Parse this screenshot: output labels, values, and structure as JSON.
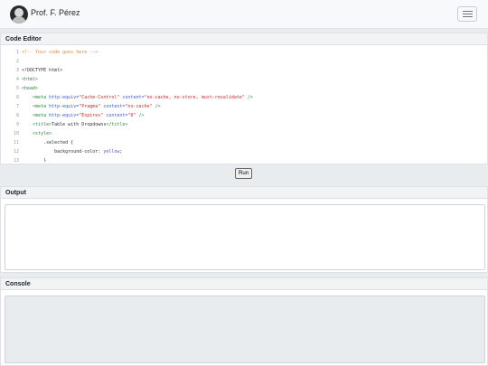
{
  "navbar": {
    "brand": "Prof. F. Pérez",
    "menu_icon": "hamburger-menu-icon"
  },
  "editor": {
    "title": "Code Editor",
    "lines": [
      {
        "n": "1",
        "segs": [
          {
            "t": "<!-- Your code goes here -->",
            "c": "comment"
          }
        ]
      },
      {
        "n": "2",
        "segs": []
      },
      {
        "n": "3",
        "segs": [
          {
            "t": "<!DOCTYPE html>",
            "c": "txt"
          }
        ]
      },
      {
        "n": "4",
        "segs": [
          {
            "t": "<html>",
            "c": "tag"
          }
        ]
      },
      {
        "n": "5",
        "segs": [
          {
            "t": "<head>",
            "c": "tag"
          }
        ]
      },
      {
        "n": "6",
        "segs": [
          {
            "t": "    <meta ",
            "c": "tag"
          },
          {
            "t": "http-equiv=",
            "c": "attr"
          },
          {
            "t": "\"Cache-Control\"",
            "c": "str"
          },
          {
            "t": " content=",
            "c": "attr"
          },
          {
            "t": "\"no-cache, no-store, must-revalidate\"",
            "c": "str"
          },
          {
            "t": " />",
            "c": "tag"
          }
        ]
      },
      {
        "n": "7",
        "segs": [
          {
            "t": "    <meta ",
            "c": "tag"
          },
          {
            "t": "http-equiv=",
            "c": "attr"
          },
          {
            "t": "\"Pragma\"",
            "c": "str"
          },
          {
            "t": " content=",
            "c": "attr"
          },
          {
            "t": "\"no-cache\"",
            "c": "str"
          },
          {
            "t": " />",
            "c": "tag"
          }
        ]
      },
      {
        "n": "8",
        "segs": [
          {
            "t": "    <meta ",
            "c": "tag"
          },
          {
            "t": "http-equiv=",
            "c": "attr"
          },
          {
            "t": "\"Expires\"",
            "c": "str"
          },
          {
            "t": " content=",
            "c": "attr"
          },
          {
            "t": "\"0\"",
            "c": "str"
          },
          {
            "t": " />",
            "c": "tag"
          }
        ]
      },
      {
        "n": "9",
        "segs": [
          {
            "t": "    <title>",
            "c": "tag"
          },
          {
            "t": "Table with Dropdowns",
            "c": "txt"
          },
          {
            "t": "</title>",
            "c": "tag"
          }
        ]
      },
      {
        "n": "10",
        "segs": [
          {
            "t": "    <style>",
            "c": "tag"
          }
        ]
      },
      {
        "n": "11",
        "segs": [
          {
            "t": "        .selected {",
            "c": "txt"
          }
        ]
      },
      {
        "n": "12",
        "segs": [
          {
            "t": "            background-color: ",
            "c": "txt"
          },
          {
            "t": "yellow",
            "c": "kw"
          },
          {
            "t": ";",
            "c": "txt"
          }
        ]
      },
      {
        "n": "13",
        "segs": [
          {
            "t": "        }",
            "c": "txt"
          }
        ]
      }
    ]
  },
  "run_label": "Run",
  "output": {
    "title": "Output"
  },
  "console": {
    "title": "Console"
  }
}
